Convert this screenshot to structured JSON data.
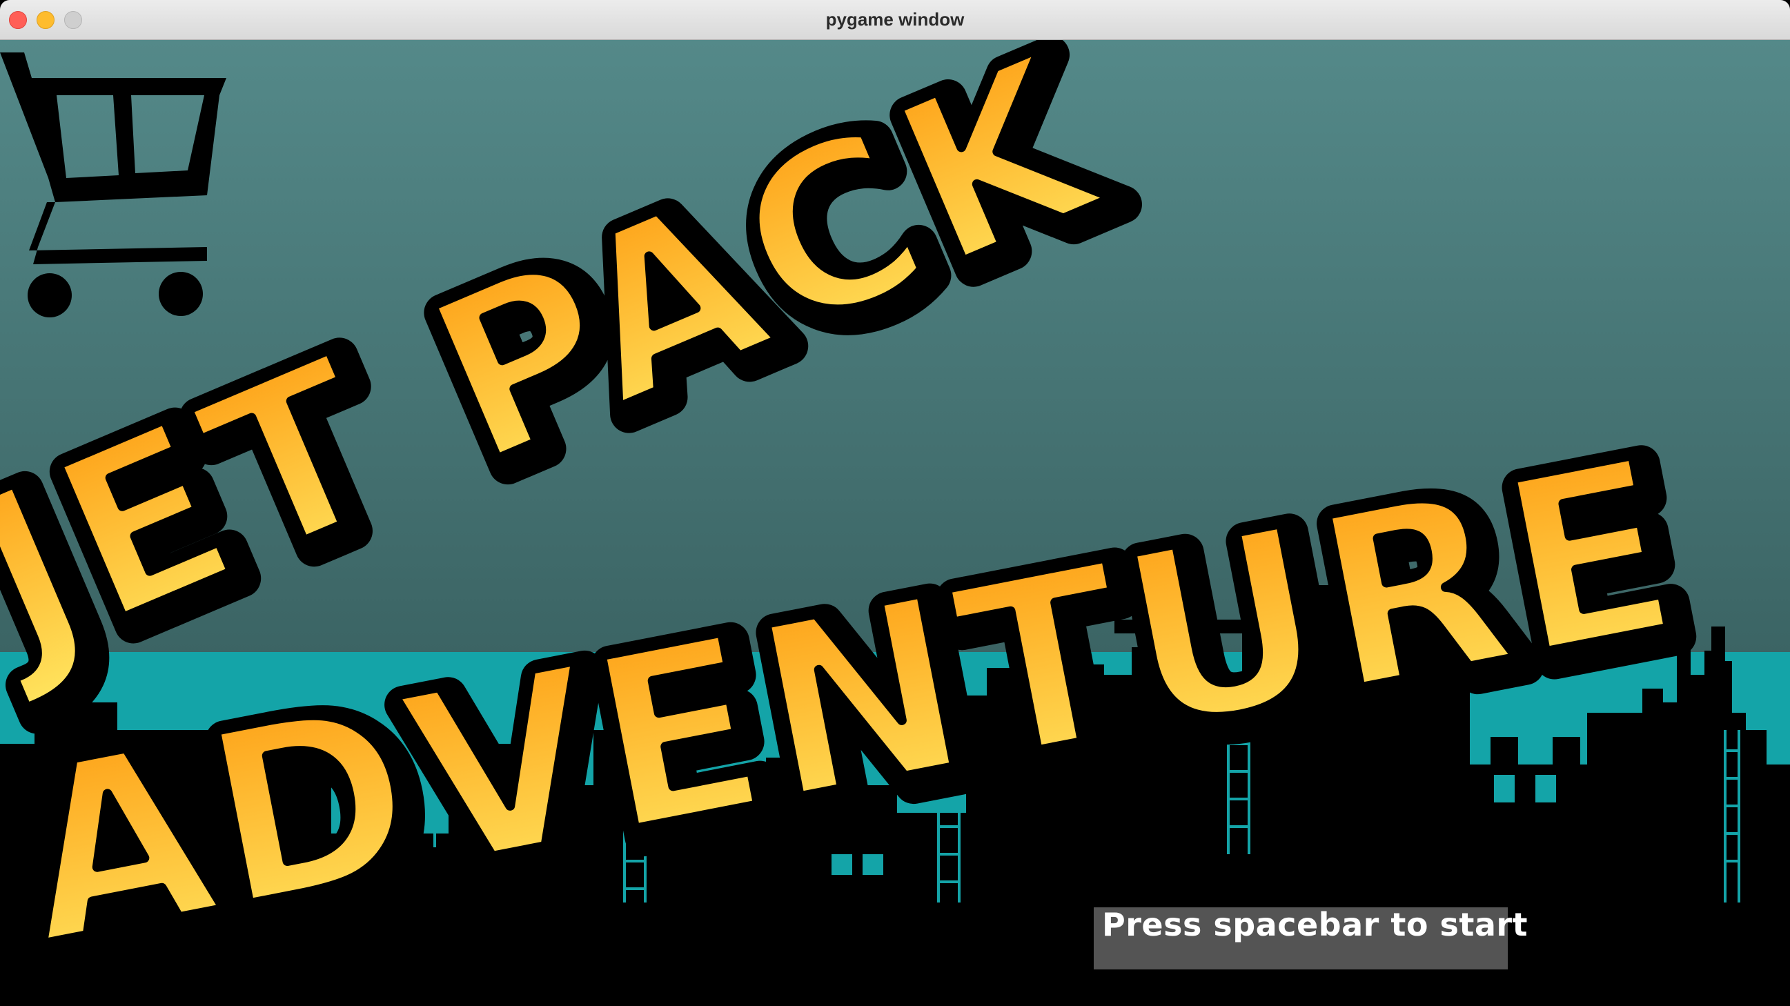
{
  "window": {
    "title": "pygame window"
  },
  "game": {
    "title_line_1": "JET PACK",
    "title_line_2": "ADVENTURE",
    "start_prompt": "Press spacebar to start",
    "shop_icon": "shopping-cart-icon"
  },
  "colors": {
    "sky_top": "#548989",
    "sky_bottom": "#2d4f4f",
    "horizon_band": "#14a4a8",
    "title_fill_top": "#fd9a10",
    "title_fill_bottom": "#ffe660",
    "prompt_background": "#545454"
  }
}
